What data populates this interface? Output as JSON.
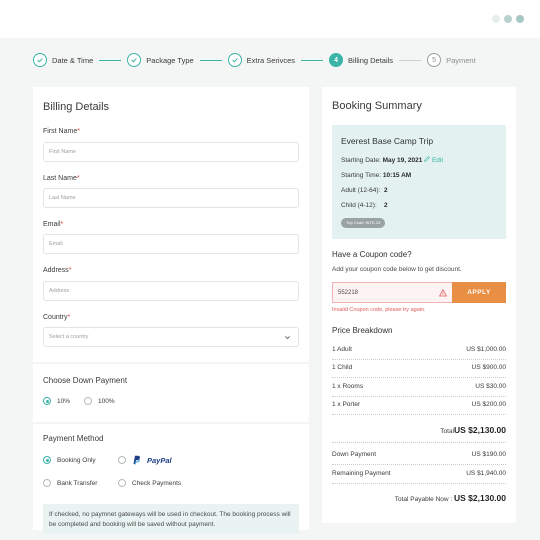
{
  "steps": [
    {
      "label": "Date & Time",
      "state": "done"
    },
    {
      "label": "Package Type",
      "state": "done"
    },
    {
      "label": "Extra Serivces",
      "state": "done"
    },
    {
      "label": "Billing Details",
      "state": "active",
      "number": "4"
    },
    {
      "label": "Payment",
      "state": "pending",
      "number": "5"
    }
  ],
  "billing": {
    "title": "Billing Details",
    "first_name": {
      "label": "First Name",
      "placeholder": "First Name"
    },
    "last_name": {
      "label": "Last Name",
      "placeholder": "Last Name"
    },
    "email": {
      "label": "Email",
      "placeholder": "Email"
    },
    "address": {
      "label": "Address",
      "placeholder": "Address"
    },
    "country": {
      "label": "Country",
      "placeholder": "Select a country"
    },
    "required_mark": "*"
  },
  "down_payment": {
    "title": "Choose Down Payment",
    "options": [
      {
        "label": "10%",
        "checked": true
      },
      {
        "label": "100%",
        "checked": false
      }
    ]
  },
  "payment_method": {
    "title": "Payment Method",
    "options": [
      {
        "label": "Booking Only",
        "checked": true
      },
      {
        "label": "PayPal",
        "checked": false
      },
      {
        "label": "Bank Transfer",
        "checked": false
      },
      {
        "label": "Check Payments",
        "checked": false
      }
    ],
    "info": "If checked, no paymnet gateways will be used in checkout. The booking process will be completed and booking will be saved without payment."
  },
  "summary": {
    "title": "Booking Summary",
    "trip": {
      "name": "Everest Base Camp Trip",
      "starting_date_label": "Starting Date:",
      "starting_date": "May 19, 2021",
      "edit": "Edit",
      "starting_time_label": "Starting Time:",
      "starting_time": "10:15 AM",
      "adult_label": "Adult (12-64):",
      "adult": "2",
      "child_label": "Child (4-12):",
      "child": "2",
      "trip_code": "Trip Code: WTE-24"
    },
    "coupon": {
      "title": "Have a Coupon code?",
      "subtitle": "Add your coupon code below to get discount.",
      "value": "552218",
      "button": "APPLY",
      "error": "Invalid Coupon code, please try again."
    },
    "price_breakdown": {
      "title": "Price Breakdown",
      "items": [
        {
          "label": "1 Adult",
          "amount": "US $1,000.00"
        },
        {
          "label": "1 Child",
          "amount": "US $900.00"
        },
        {
          "label": "1 x Rooms",
          "amount": "US $30.00"
        },
        {
          "label": "1 x Porter",
          "amount": "US $200.00"
        }
      ],
      "total_label": "Total",
      "total": "US $2,130.00",
      "down_payment_label": "Down Payment",
      "down_payment": "US $190.00",
      "remaining_label": "Remaining Payment",
      "remaining": "US $1,940.00",
      "payable_label": "Total Payable Now :",
      "payable": "US $2,130.00"
    }
  },
  "colors": {
    "accent": "#3bb3a6",
    "apply": "#e98f43",
    "error": "#e35a5a"
  }
}
